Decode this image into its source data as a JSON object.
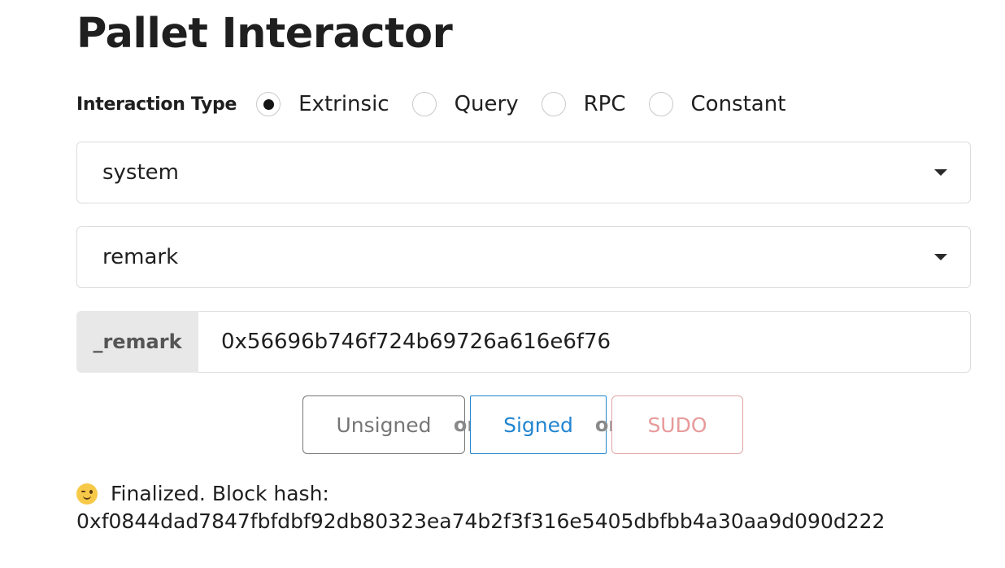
{
  "page": {
    "title": "Pallet Interactor"
  },
  "interaction": {
    "label": "Interaction Type",
    "options": [
      {
        "label": "Extrinsic",
        "checked": true
      },
      {
        "label": "Query",
        "checked": false
      },
      {
        "label": "RPC",
        "checked": false
      },
      {
        "label": "Constant",
        "checked": false
      }
    ]
  },
  "pallet_select": {
    "value": "system",
    "icon": "chevron-down-icon"
  },
  "callable_select": {
    "value": "remark",
    "icon": "chevron-down-icon"
  },
  "param": {
    "label": "_remark",
    "value": "0x56696b746f724b69726a616e6f76"
  },
  "buttons": {
    "unsigned": "Unsigned",
    "or1": "or",
    "signed": "Signed",
    "or2": "or",
    "sudo": "SUDO"
  },
  "colors": {
    "signed": "#2185d0",
    "sudo": "#e79a9a",
    "unsigned": "#767676"
  },
  "status": {
    "icon": "winking-face-emoji",
    "line1": "Finalized. Block hash:",
    "line2": "0xf0844dad7847fbfdbf92db80323ea74b2f3f316e5405dbfbb4a30aa9d090d222"
  }
}
